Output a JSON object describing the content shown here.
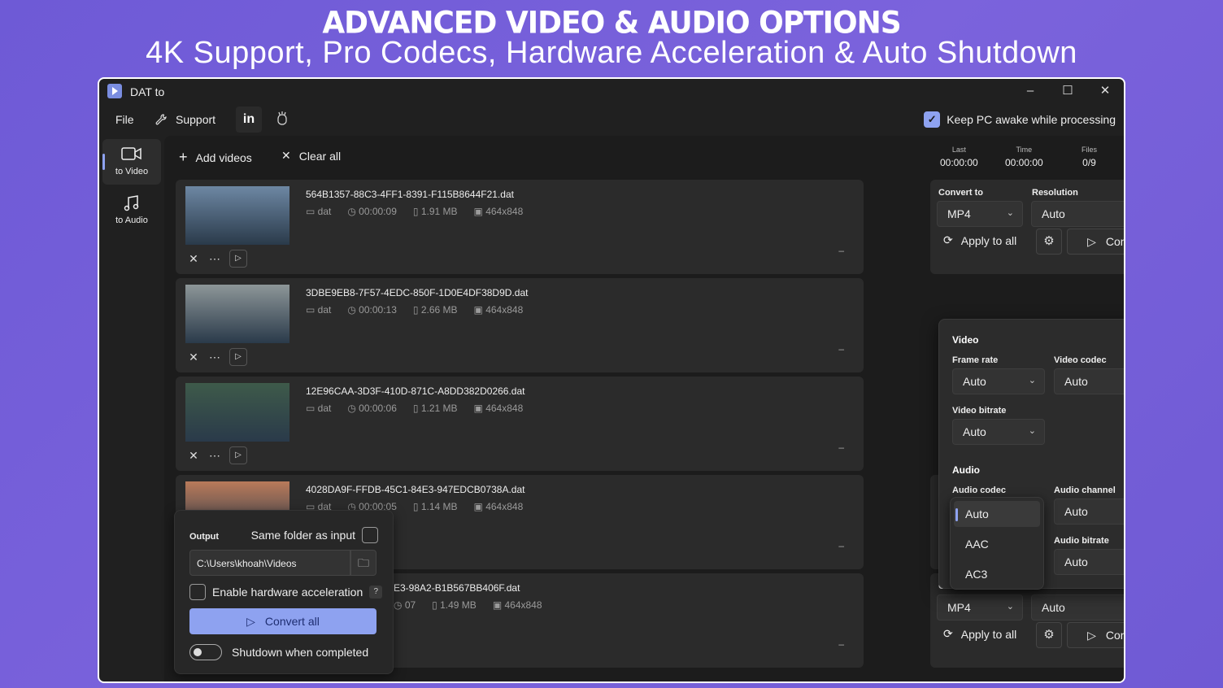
{
  "banner": {
    "title": "ADVANCED VIDEO & AUDIO OPTIONS",
    "subtitle": "4K Support, Pro Codecs, Hardware Acceleration & Auto Shutdown"
  },
  "window": {
    "title": "DAT to",
    "controls": {
      "minimize": "–",
      "maximize": "☐",
      "close": "✕"
    }
  },
  "menu": {
    "file": "File",
    "support": "Support",
    "linkedin": "in",
    "keep_awake": "Keep PC awake while processing",
    "keep_awake_checked": true
  },
  "sidebar": {
    "items": [
      {
        "label": "to Video",
        "icon": "video-camera-icon",
        "active": true
      },
      {
        "label": "to Audio",
        "icon": "music-note-icon",
        "active": false
      }
    ]
  },
  "toolbar": {
    "add_videos": "Add videos",
    "clear_all": "Clear all",
    "stats": {
      "last_label": "Last",
      "last_value": "00:00:00",
      "time_label": "Time",
      "time_value": "00:00:00",
      "files_label": "Files",
      "files_value": "0/9"
    }
  },
  "files": [
    {
      "name": "564B1357-88C3-4FF1-8391-F115B8644F21.dat",
      "format": "dat",
      "duration": "00:00:09",
      "size": "1.91 MB",
      "dims": "464x848",
      "thumb_color": "#6d87a3"
    },
    {
      "name": "3DBE9EB8-7F57-4EDC-850F-1D0E4DF38D9D.dat",
      "format": "dat",
      "duration": "00:00:13",
      "size": "2.66 MB",
      "dims": "464x848",
      "thumb_color": "#8d9698"
    },
    {
      "name": "12E96CAA-3D3F-410D-871C-A8DD382D0266.dat",
      "format": "dat",
      "duration": "00:00:06",
      "size": "1.21 MB",
      "dims": "464x848",
      "thumb_color": "#3e5a4a"
    },
    {
      "name": "4028DA9F-FFDB-45C1-84E3-947EDCB0738A.dat",
      "format": "dat",
      "duration": "00:00:05",
      "size": "1.14 MB",
      "dims": "464x848",
      "thumb_color": "#b97a5a"
    },
    {
      "name": "E3-98A2-B1B567BB406F.dat",
      "duration": "07",
      "size": "1.49 MB",
      "dims": "464x848"
    }
  ],
  "row_panel": {
    "convert_to_label": "Convert to",
    "convert_to_value": "MP4",
    "resolution_label": "Resolution",
    "resolution_value": "Auto",
    "apply_to_all": "Apply to all",
    "convert": "Convert"
  },
  "settings_popup": {
    "video_heading": "Video",
    "frame_rate_label": "Frame rate",
    "frame_rate_value": "Auto",
    "video_codec_label": "Video codec",
    "video_codec_value": "Auto",
    "video_bitrate_label": "Video bitrate",
    "video_bitrate_value": "Auto",
    "audio_heading": "Audio",
    "audio_codec_label": "Audio codec",
    "audio_channel_label": "Audio channel",
    "audio_channel_value": "Auto",
    "audio_bitrate_label": "Audio bitrate",
    "audio_bitrate_value": "Auto",
    "audio_codec_options": [
      "Auto",
      "AAC",
      "AC3"
    ]
  },
  "output_panel": {
    "output_label": "Output",
    "same_folder": "Same folder as input",
    "path": "C:\\Users\\khoah\\Videos",
    "hw_accel": "Enable hardware acceleration",
    "help": "?",
    "convert_all": "Convert all",
    "shutdown": "Shutdown when completed"
  },
  "colors": {
    "accent": "#8ea2f0",
    "background": "#1c1c1c",
    "banner": "#7b63dc"
  }
}
